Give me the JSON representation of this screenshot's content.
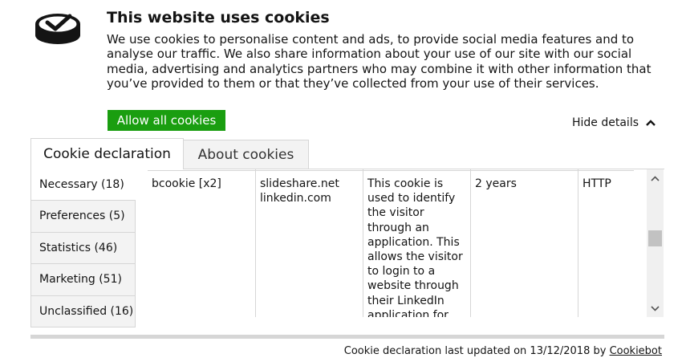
{
  "header": {
    "logo_icon": "cookiebot-check-logo-icon",
    "title": "This website uses cookies",
    "description": "We use cookies to personalise content and ads, to provide social media features and to analyse our traffic. We also share information about your use of our site with our social media, advertising and analytics partners who may combine it with other information that you’ve provided to them or that they’ve collected from your use of their services."
  },
  "actions": {
    "allow_all_label": "Allow all cookies",
    "allow_all_color": "#1a9e10",
    "hide_details_label": "Hide details",
    "hide_details_icon": "chevron-up-icon"
  },
  "tabs": [
    {
      "label": "Cookie declaration",
      "active": true
    },
    {
      "label": "About cookies",
      "active": false
    }
  ],
  "categories": [
    {
      "label": "Necessary (18)",
      "active": true
    },
    {
      "label": "Preferences (5)",
      "active": false
    },
    {
      "label": "Statistics (46)",
      "active": false
    },
    {
      "label": "Marketing (51)",
      "active": false
    },
    {
      "label": "Unclassified (16)",
      "active": false
    }
  ],
  "cookie_row": {
    "name": "bcookie [x2]",
    "domains": [
      "slideshare.net",
      "linkedin.com"
    ],
    "purpose": "This cookie is used to identify the visitor through an application. This allows the visitor to login to a website through their LinkedIn application for example.",
    "expiry": "2 years",
    "type": "HTTP"
  },
  "scrollbar": {
    "up_icon": "scroll-up-arrow-icon",
    "down_icon": "scroll-down-arrow-icon",
    "position_fraction": 0.45
  },
  "footer": {
    "text": "Cookie declaration last updated on 13/12/2018 by ",
    "link_label": "Cookiebot"
  }
}
